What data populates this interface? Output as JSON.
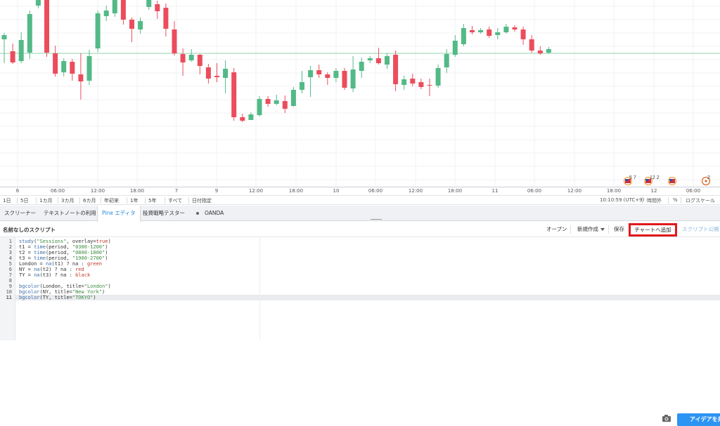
{
  "chart": {
    "candles": [
      {
        "o": 56,
        "c": 50,
        "h": 47,
        "l": 90
      },
      {
        "o": 73,
        "c": 89,
        "h": 62,
        "l": 91
      },
      {
        "o": 87,
        "c": 57,
        "h": 46,
        "l": 90
      },
      {
        "o": 75,
        "c": 20,
        "h": 15,
        "l": 84
      },
      {
        "o": 8,
        "c": -11,
        "h": -15,
        "l": 12
      },
      {
        "o": -3,
        "c": 75,
        "h": -7,
        "l": 81
      },
      {
        "o": 76,
        "c": 105,
        "h": 65,
        "l": 109
      },
      {
        "o": 103,
        "c": 87,
        "h": 83,
        "l": 109
      },
      {
        "o": 88,
        "c": 105,
        "h": 84,
        "l": 115
      },
      {
        "o": 106,
        "c": 116,
        "h": 76,
        "l": 142
      },
      {
        "o": 115,
        "c": 80,
        "h": 71,
        "l": 121
      },
      {
        "o": 69,
        "c": 19,
        "h": 15,
        "l": 74
      },
      {
        "o": 23,
        "c": 15,
        "h": 8,
        "l": 30
      },
      {
        "o": 19,
        "c": -6,
        "h": -9,
        "l": 24
      },
      {
        "o": 0,
        "c": 28,
        "h": -3,
        "l": 35
      },
      {
        "o": 28,
        "c": 41,
        "h": 25,
        "l": 60
      },
      {
        "o": 42,
        "c": 30,
        "h": 25,
        "l": 48
      },
      {
        "o": 10,
        "c": -2,
        "h": -4,
        "l": 14
      },
      {
        "o": 6,
        "c": 16,
        "h": 1,
        "l": 27
      },
      {
        "o": 11,
        "c": 41,
        "h": 5,
        "l": 52
      },
      {
        "o": 42,
        "c": 76,
        "h": 30,
        "l": 79
      },
      {
        "o": 77,
        "c": 89,
        "h": 69,
        "l": 108
      },
      {
        "o": 86,
        "c": 78,
        "h": 70,
        "l": 88
      },
      {
        "o": 78,
        "c": 94,
        "h": 77,
        "l": 106
      },
      {
        "o": 96,
        "c": 112,
        "h": 91,
        "l": 119
      },
      {
        "o": 108,
        "c": 110,
        "h": 90,
        "l": 117
      },
      {
        "o": 111,
        "c": 98,
        "h": 86,
        "l": 133
      },
      {
        "o": 103,
        "c": 167,
        "h": 97,
        "l": 172
      },
      {
        "o": 167,
        "c": 172,
        "h": 162,
        "l": 174
      },
      {
        "o": 171,
        "c": 163,
        "h": 160,
        "l": 170
      },
      {
        "o": 164,
        "c": 141,
        "h": 137,
        "l": 166
      },
      {
        "o": 141,
        "c": 148,
        "h": 137,
        "l": 152
      },
      {
        "o": 148,
        "c": 143,
        "h": 135,
        "l": 150
      },
      {
        "o": 144,
        "c": 155,
        "h": 136,
        "l": 161
      },
      {
        "o": 151,
        "c": 128,
        "h": 124,
        "l": 152
      },
      {
        "o": 128,
        "c": 117,
        "h": 101,
        "l": 133
      },
      {
        "o": 110,
        "c": 100,
        "h": 94,
        "l": 138
      },
      {
        "o": 100,
        "c": 106,
        "h": 92,
        "l": 111
      },
      {
        "o": 106,
        "c": 111,
        "h": 103,
        "l": 121
      },
      {
        "o": 111,
        "c": 101,
        "h": 97,
        "l": 117
      },
      {
        "o": 101,
        "c": 125,
        "h": 97,
        "l": 128
      },
      {
        "o": 126,
        "c": 99,
        "h": 80,
        "l": 131
      },
      {
        "o": 101,
        "c": 88,
        "h": 82,
        "l": 111
      },
      {
        "o": 86,
        "c": 83,
        "h": 80,
        "l": 90
      },
      {
        "o": 83,
        "c": 90,
        "h": 68,
        "l": 92
      },
      {
        "o": 92,
        "c": 80,
        "h": 76,
        "l": 98
      },
      {
        "o": 78,
        "c": 120,
        "h": 72,
        "l": 130
      },
      {
        "o": 121,
        "c": 113,
        "h": 108,
        "l": 128
      },
      {
        "o": 112,
        "c": 119,
        "h": 105,
        "l": 123
      },
      {
        "o": 117,
        "c": 124,
        "h": 112,
        "l": 127
      },
      {
        "o": 121,
        "c": 122,
        "h": 112,
        "l": 137
      },
      {
        "o": 122,
        "c": 97,
        "h": 92,
        "l": 125
      },
      {
        "o": 96,
        "c": 77,
        "h": 70,
        "l": 104
      },
      {
        "o": 78,
        "c": 58,
        "h": 50,
        "l": 81
      },
      {
        "o": 63,
        "c": 40,
        "h": 34,
        "l": 66
      },
      {
        "o": 43,
        "c": 46,
        "h": 37,
        "l": 49
      },
      {
        "o": 46,
        "c": 43,
        "h": 40,
        "l": 48
      },
      {
        "o": 42,
        "c": 51,
        "h": 38,
        "l": 54
      },
      {
        "o": 50,
        "c": 46,
        "h": 40,
        "l": 56
      },
      {
        "o": 46,
        "c": 38,
        "h": 34,
        "l": 48
      },
      {
        "o": 39,
        "c": 42,
        "h": 36,
        "l": 45
      },
      {
        "o": 42,
        "c": 56,
        "h": 38,
        "l": 64
      },
      {
        "o": 56,
        "c": 72,
        "h": 50,
        "l": 75
      },
      {
        "o": 72,
        "c": 76,
        "h": 66,
        "l": 78
      },
      {
        "o": 75,
        "c": 70,
        "h": 67,
        "l": 77
      }
    ],
    "current_price_line_color": "#8fd3a8",
    "up_color": "#53b987",
    "down_color": "#eb4d5c"
  },
  "time_axis": {
    "ticks": [
      "6",
      "06:00",
      "12:00",
      "18:00",
      "7",
      "9",
      "12:00",
      "18:00",
      "10",
      "06:00",
      "12:00",
      "18:00",
      "11",
      "06:00",
      "12:00",
      "18:00",
      "12",
      "06:00"
    ]
  },
  "event_badges": [
    {
      "label": "5 7",
      "icon": "us-flag-icon"
    },
    {
      "label": "12 2",
      "icon": "us-flag-icon"
    },
    {
      "label": "",
      "icon": "us-flag-icon"
    },
    {
      "label": "2",
      "icon": "event-icon"
    }
  ],
  "range_bar": {
    "buttons": [
      "1日",
      "5日",
      "1カ月",
      "3カ月",
      "6カ月",
      "年初来",
      "1年",
      "5年",
      "すべて",
      "日付指定"
    ],
    "clock": "10:10:59 (UTC+9)",
    "session": "時間外",
    "percent": "%",
    "log_scale": "ログスケール"
  },
  "tabs": {
    "items": [
      "スクリーナー",
      "テキストノートの利用",
      "Pine エディタ",
      "投資戦略テスター",
      "OANDA"
    ],
    "active_index": 2,
    "idea_button": "アイデアを共有"
  },
  "editor": {
    "title": "名前なしのスクリプト",
    "open": "オープン",
    "new": "新規作成",
    "save": "保存",
    "add_to_chart": "チャートへ追加",
    "publish": "スクリプト公開",
    "highlight_color": "#e0191c"
  },
  "code": {
    "lines": [
      "study(\"Sessions\", overlay=true)",
      "t1 = time(period, \"0300-1200\")",
      "t2 = time(period, \"0800-1800\")",
      "t3 = time(period, \"1900-2700\")",
      "London = na(t1) ? na : green",
      "NY = na(t2) ? na : red",
      "TY = na(t3) ? na : black",
      "",
      "bgcolor(London, title=\"London\")",
      "bgcolor(NY, title=\"New York\")",
      "bgcolor(TY, title=\"TOKYO\")"
    ],
    "active_line": 11
  }
}
